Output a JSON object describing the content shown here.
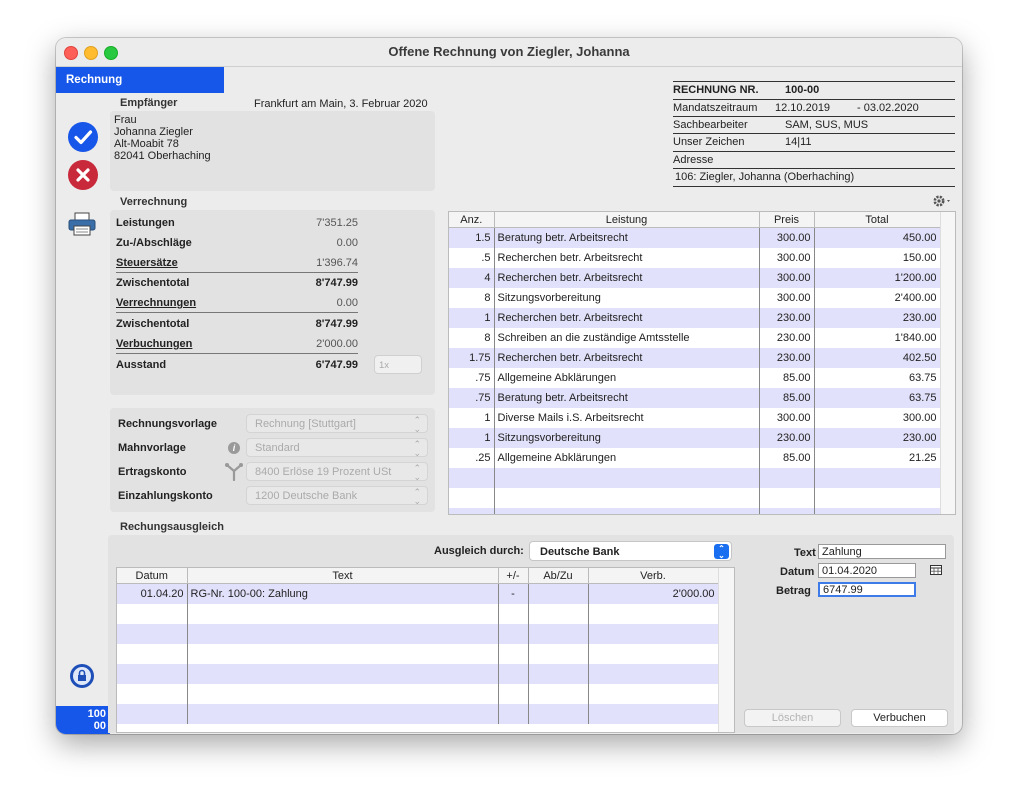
{
  "window": {
    "title": "Offene Rechnung von Ziegler, Johanna"
  },
  "tab": {
    "label": "Rechnung"
  },
  "sidebar": {
    "bottom_number_line1": "100",
    "bottom_number_line2": "00"
  },
  "recipient": {
    "label": "Empfänger",
    "place_date": "Frankfurt am Main, 3. Februar 2020",
    "lines": [
      "Frau",
      "Johanna Ziegler",
      "Alt-Moabit 78",
      "82041 Oberhaching"
    ]
  },
  "info": {
    "invoice_label": "RECHNUNG NR.",
    "invoice_no": "100-00",
    "period_label": "Mandatszeitraum",
    "period_from": "12.10.2019",
    "period_to": "- 03.02.2020",
    "clerk_label": "Sachbearbeiter",
    "clerk_value": "SAM, SUS, MUS",
    "ref_label": "Unser Zeichen",
    "ref_value": "14|11",
    "address_label": "Adresse",
    "address_value": "106: Ziegler, Johanna (Oberhaching)"
  },
  "settlement": {
    "label": "Verrechnung",
    "rows": [
      {
        "label": "Leistungen",
        "value": "7'351.25"
      },
      {
        "label": "Zu-/Abschläge",
        "value": "0.00"
      },
      {
        "label": "Steuersätze",
        "value": "1'396.74"
      },
      {
        "label": "Zwischentotal",
        "value": "8'747.99"
      },
      {
        "label": "Verrechnungen",
        "value": "0.00"
      },
      {
        "label": "Zwischentotal",
        "value": "8'747.99"
      },
      {
        "label": "Verbuchungen",
        "value": "2'000.00"
      },
      {
        "label": "Ausstand",
        "value": "6'747.99"
      }
    ],
    "copies_placeholder": "1x"
  },
  "templates": {
    "invoice_template_label": "Rechnungsvorlage",
    "invoice_template_value": "Rechnung [Stuttgart]",
    "reminder_template_label": "Mahnvorlage",
    "reminder_template_value": "Standard",
    "revenue_account_label": "Ertragskonto",
    "revenue_account_value": "8400 Erlöse 19 Prozent USt",
    "payment_account_label": "Einzahlungskonto",
    "payment_account_value": "1200 Deutsche Bank"
  },
  "services": {
    "headers": {
      "qty": "Anz.",
      "service": "Leistung",
      "price": "Preis",
      "total": "Total"
    },
    "rows": [
      {
        "qty": "1.5",
        "service": "Beratung betr. Arbeitsrecht",
        "price": "300.00",
        "total": "450.00"
      },
      {
        "qty": ".5",
        "service": "Recherchen betr. Arbeitsrecht",
        "price": "300.00",
        "total": "150.00"
      },
      {
        "qty": "4",
        "service": "Recherchen betr. Arbeitsrecht",
        "price": "300.00",
        "total": "1'200.00"
      },
      {
        "qty": "8",
        "service": "Sitzungsvorbereitung",
        "price": "300.00",
        "total": "2'400.00"
      },
      {
        "qty": "1",
        "service": "Recherchen betr. Arbeitsrecht",
        "price": "230.00",
        "total": "230.00"
      },
      {
        "qty": "8",
        "service": "Schreiben an die zuständige Amtsstelle",
        "price": "230.00",
        "total": "1'840.00"
      },
      {
        "qty": "1.75",
        "service": "Recherchen betr. Arbeitsrecht",
        "price": "230.00",
        "total": "402.50"
      },
      {
        "qty": ".75",
        "service": "Allgemeine Abklärungen",
        "price": "85.00",
        "total": "63.75"
      },
      {
        "qty": ".75",
        "service": "Beratung betr. Arbeitsrecht",
        "price": "85.00",
        "total": "63.75"
      },
      {
        "qty": "1",
        "service": "Diverse Mails i.S. Arbeitsrecht",
        "price": "300.00",
        "total": "300.00"
      },
      {
        "qty": "1",
        "service": "Sitzungsvorbereitung",
        "price": "230.00",
        "total": "230.00"
      },
      {
        "qty": ".25",
        "service": "Allgemeine Abklärungen",
        "price": "85.00",
        "total": "21.25"
      }
    ]
  },
  "payment": {
    "label": "Rechungsausgleich",
    "via_label": "Ausgleich durch:",
    "via_value": "Deutsche Bank",
    "headers": {
      "date": "Datum",
      "text": "Text",
      "sign": "+/-",
      "deduct": "Ab/Zu",
      "booked": "Verb."
    },
    "rows": [
      {
        "date": "01.04.20",
        "text": "RG-Nr. 100-00: Zahlung",
        "sign": "-",
        "deduct": "",
        "booked": "2'000.00"
      }
    ],
    "form": {
      "text_label": "Text",
      "text_value": "Zahlung",
      "date_label": "Datum",
      "date_value": "01.04.2020",
      "amount_label": "Betrag",
      "amount_value": "6747.99"
    },
    "delete_button": "Löschen",
    "book_button": "Verbuchen"
  }
}
